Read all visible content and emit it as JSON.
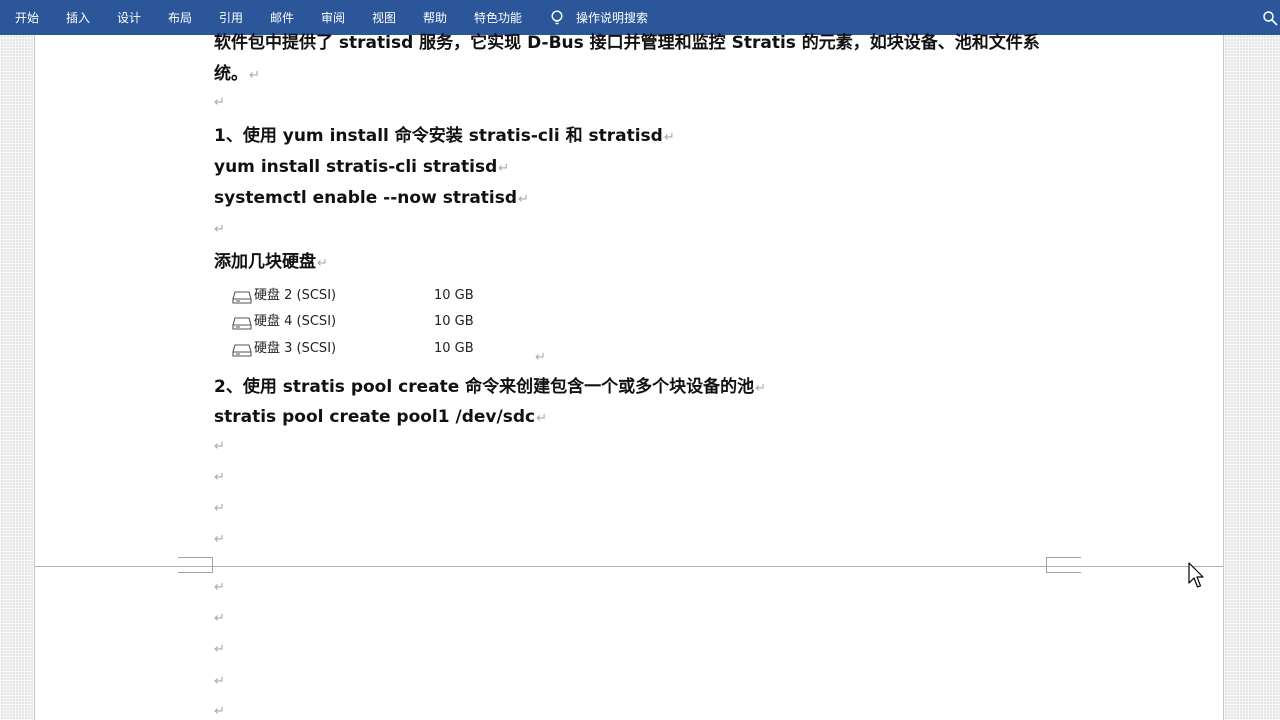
{
  "ribbon": {
    "tabs": [
      "开始",
      "插入",
      "设计",
      "布局",
      "引用",
      "邮件",
      "审阅",
      "视图",
      "帮助",
      "特色功能"
    ],
    "tell_me": "操作说明搜索"
  },
  "document": {
    "intro_line1": "软件包中提供了 stratisd 服务，它实现 D-Bus 接口并管理和监控 Stratis 的元素，如块设备、池和文件系",
    "intro_line2": "统。",
    "step1_heading": "1、使用 yum install 命令安装 stratis-cli 和 stratisd",
    "cmd1": "yum install stratis-cli stratisd",
    "cmd2": "systemctl enable --now stratisd",
    "add_disks": "添加几块硬盘",
    "disks": [
      {
        "name": "硬盘 2 (SCSI)",
        "size": "10 GB"
      },
      {
        "name": "硬盘 4 (SCSI)",
        "size": "10 GB"
      },
      {
        "name": "硬盘 3 (SCSI)",
        "size": "10 GB"
      }
    ],
    "step2_heading": "2、使用 stratis pool create 命令来创建包含一个或多个块设备的池",
    "cmd3": "stratis pool create pool1 /dev/sdc",
    "paragraph_mark": "↵"
  }
}
